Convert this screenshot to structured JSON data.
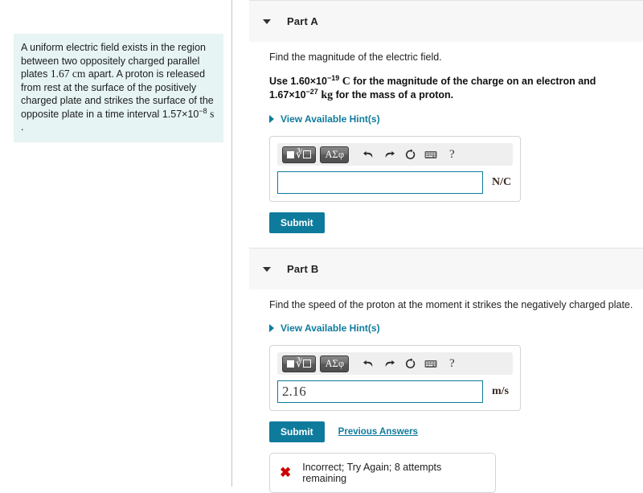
{
  "problem": {
    "text_line1": "A uniform electric field exists in the region between",
    "text_line2_pre": "two oppositely charged parallel plates ",
    "text_line2_value": "1.67 cm",
    "text_line3": "apart. A proton is released from rest at the surface",
    "text_line4": "of the positively charged plate and strikes the",
    "text_line5": "surface of the opposite plate in a time interval",
    "time_mantissa": "1.57×10",
    "time_exponent": "−8",
    "time_unit": "s ."
  },
  "parts": [
    {
      "title": "Part A",
      "caret_icon": "caret-down-icon",
      "question": "Find the magnitude of the electric field.",
      "constants": {
        "pre": "Use 1.60×10",
        "exp1": "−19",
        "mid1": " C",
        "mid2": " for the magnitude of the charge on an electron and 1.67×10",
        "exp2": "−27",
        "mid3": " kg",
        "post": " for the mass of a proton."
      },
      "hint_label": "View Available Hint(s)",
      "toolbar": {
        "template_button": "math-template-button",
        "greek_button": "ΑΣφ",
        "undo_icon": "undo-arrow-icon",
        "redo_icon": "redo-arrow-icon",
        "reset_icon": "reset-circular-arrow-icon",
        "keyboard_icon": "keyboard-icon",
        "help_icon": "?"
      },
      "answer_value": "",
      "answer_placeholder": "",
      "unit": "N/C",
      "submit_label": "Submit",
      "previous_answers_label": null,
      "feedback": null
    },
    {
      "title": "Part B",
      "caret_icon": "caret-down-icon",
      "question": "Find the speed of the proton at the moment it strikes the negatively charged plate.",
      "constants": null,
      "hint_label": "View Available Hint(s)",
      "toolbar": {
        "template_button": "math-template-button",
        "greek_button": "ΑΣφ",
        "undo_icon": "undo-arrow-icon",
        "redo_icon": "redo-arrow-icon",
        "reset_icon": "reset-circular-arrow-icon",
        "keyboard_icon": "keyboard-icon",
        "help_icon": "?"
      },
      "answer_value": "2.16",
      "answer_placeholder": "",
      "unit": "m/s",
      "submit_label": "Submit",
      "previous_answers_label": "Previous Answers",
      "feedback": {
        "icon": "x-mark-icon",
        "symbol": "✖",
        "text": "Incorrect; Try Again; 8 attempts remaining"
      }
    }
  ],
  "colors": {
    "accent_teal": "#0f7b9c",
    "problem_bg": "#e6f4f3",
    "header_bg": "#f7f7f7",
    "error_red": "#cc0000"
  }
}
